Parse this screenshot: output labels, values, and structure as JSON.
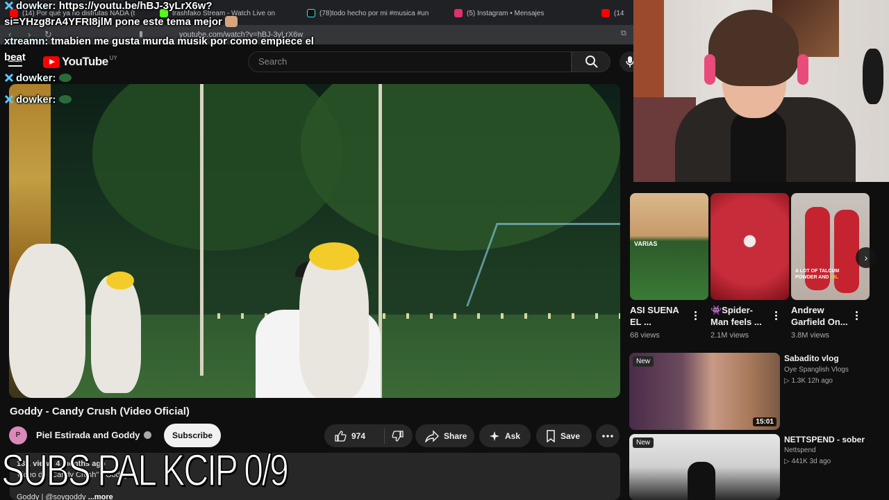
{
  "browser": {
    "tabs": [
      {
        "label": "(14) Por qué ya no disfrutas NADA (t",
        "color": "#ff0000"
      },
      {
        "label": "trashfako Stream - Watch Live on",
        "color": "#53fc18"
      },
      {
        "label": "(78)todo hecho por mi #musica #un",
        "color": "#25f4ee"
      },
      {
        "label": "(5) Instagram • Mensajes",
        "color": "#e1306c"
      },
      {
        "label": "(14",
        "color": "#ff0000"
      }
    ],
    "url": "youtube.com/watch?v=hBJ-3yLrX6w"
  },
  "youtube": {
    "logo_text": "YouTube",
    "country_code": "UY",
    "search_placeholder": "Search"
  },
  "video": {
    "title": "Goddy - Candy Crush (Video Oficial)",
    "channel_initial": "P",
    "channel_name": "Piel Estirada and Goddy",
    "subscribe_label": "Subscribe",
    "like_count": "974",
    "share_label": "Share",
    "ask_label": "Ask",
    "save_label": "Save",
    "description_stats": "13K views  4 months ago",
    "description_text": "Video de \"Candy Crush\" - Goddy.",
    "description_author": "Goddy | @soygoddy",
    "description_more": "...more"
  },
  "shorts": [
    {
      "title_line1": "ASI SUENA",
      "title_line2": "EL ...",
      "views": "68 views",
      "label": "VARIAS",
      "caption": ""
    },
    {
      "title_line1": "👾Spider-",
      "title_line2": "Man feels ...",
      "views": "2.1M views",
      "label": "",
      "caption": ""
    },
    {
      "title_line1": "Andrew",
      "title_line2": "Garfield On...",
      "views": "3.8M views",
      "label": "",
      "caption_a": "A LOT OF TALCUM",
      "caption_b": "POWDER AND",
      "caption_c": "OIL"
    }
  ],
  "recommended": [
    {
      "badge": "New",
      "duration": "15:01",
      "title": "Sabadito vlog",
      "channel": "Oye Spanglish Vlogs",
      "meta": "▷ 1.3K  12h ago"
    },
    {
      "badge": "New",
      "duration": "",
      "title": "NETTSPEND - sober",
      "channel": "Nettspend",
      "meta": "▷ 441K  3d ago"
    }
  ],
  "chat": [
    {
      "user": "dowker:",
      "message": "https://youtu.be/hBJ-3yLrX6w?"
    },
    {
      "user": "",
      "message": "si=YHzg8rA4YFRI8jlM pone este tema mejor"
    },
    {
      "user": "xtreamn:",
      "message": "tmabien me gusta murda musik por como empiece el"
    },
    {
      "user": "",
      "message": "beat"
    },
    {
      "user": "dowker:",
      "message": ""
    },
    {
      "user": "dowker:",
      "message": ""
    }
  ],
  "overlay_text": "SUBS PAL KCIP 0/9",
  "colors": {
    "background": "#0f0f0f",
    "youtube_red": "#ff0000",
    "pill": "#272727",
    "subscribe_bg": "#f1f1f1"
  }
}
